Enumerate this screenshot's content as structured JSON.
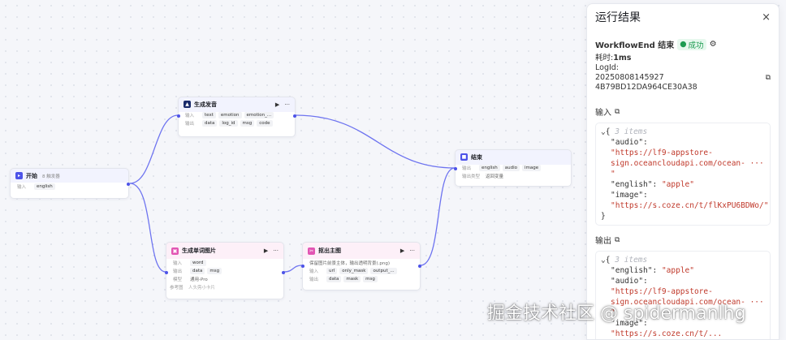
{
  "nodes": {
    "start": {
      "title": "开始",
      "sub": "8 触发器",
      "input_label": "输入",
      "vars": [
        "english"
      ]
    },
    "audio": {
      "title": "生成发音",
      "input_label": "输入",
      "inputs": [
        "text",
        "emotion",
        "emotion_..."
      ],
      "output_label": "输出",
      "outputs": [
        "data",
        "log_id",
        "msg",
        "code"
      ]
    },
    "end": {
      "title": "结束",
      "output_label": "输出",
      "outputs": [
        "english",
        "audio",
        "image"
      ],
      "mode_label": "输出类型",
      "mode_value": "返回变量"
    },
    "image": {
      "title": "生成单词图片",
      "input_label": "输入",
      "inputs": [
        "word"
      ],
      "output_label": "输出",
      "outputs": [
        "data",
        "msg"
      ],
      "model_label": "模型",
      "model_value": "通用-Pro",
      "ref_label": "参考图",
      "ref_value": "人头旁小卡片"
    },
    "cutout": {
      "title": "抠出主图",
      "desc": "保留图片前景主体，输出透明背景(.png)",
      "input_label": "输入",
      "inputs": [
        "url",
        "only_mask",
        "output_..."
      ],
      "output_label": "输出",
      "outputs": [
        "data",
        "mask",
        "msg"
      ]
    }
  },
  "panel": {
    "title": "运行结果",
    "close_icon": "×",
    "node_name": "WorkflowEnd 结束",
    "status": "成功",
    "time_label": "耗时:",
    "time_value": "1ms",
    "logid_label": "LogId:",
    "logid_value": "20250808145927 4B79BD12DA964CE30A38",
    "input_title": "输入",
    "output_title": "输出",
    "input": {
      "count": "3 items",
      "audio_key": "\"audio\":",
      "audio_val_1": "\"https://lf9-appstore-",
      "audio_val_2": "sign.oceancloudapi.com/ocean- ··· \"",
      "english_key": "\"english\":",
      "english_val": "\"apple\"",
      "image_key": "\"image\":",
      "image_val": "\"https://s.coze.cn/t/flKxPU6BDWo/\""
    },
    "output": {
      "count": "3 items",
      "english_key": "\"english\":",
      "english_val": "\"apple\"",
      "audio_key": "\"audio\":",
      "audio_val_1": "\"https://lf9-appstore-",
      "audio_val_2": "sign.oceancloudapi.com/ocean- ··· \"",
      "image_key": "\"image\":",
      "image_val": "\"https://s.coze.cn/t/..."
    }
  },
  "watermark": "掘金技术社区 @ spidermanlhg",
  "colors": {
    "accent": "#4d53e8",
    "success": "#1d9b51",
    "string": "#c0392b"
  }
}
